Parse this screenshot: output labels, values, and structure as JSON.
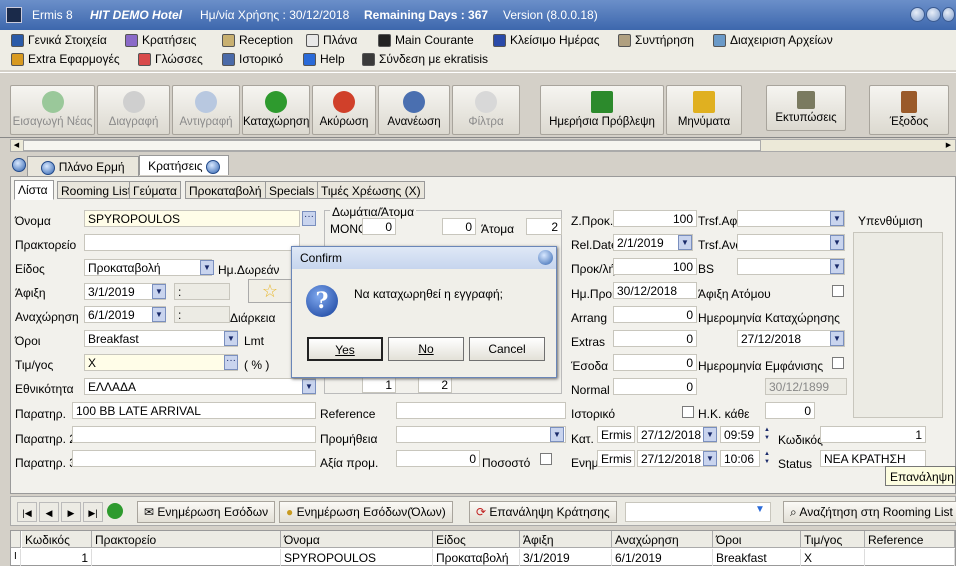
{
  "titlebar": {
    "app": "Ermis 8",
    "hotel": "HIT DEMO Hotel",
    "date_label": "Ημ/νία Χρήσης : 30/12/2018",
    "remaining": "Remaining Days : 367",
    "version": "Version (8.0.0.18)"
  },
  "menu": {
    "row1": [
      "Γενικά Στοιχεία",
      "Κρατήσεις",
      "Reception",
      "Πλάνα",
      "Main Courante",
      "Κλείσιμο Ημέρας",
      "Συντήρηση",
      "Διαχειριση Αρχείων"
    ],
    "row2": [
      "Extra Εφαρμογές",
      "Γλώσσες",
      "Ιστορικό",
      "Help",
      "Σύνδεση με ekratisis"
    ]
  },
  "toolbar": {
    "new": "Εισαγωγή Νέας",
    "delete": "Διαγραφή",
    "copy": "Αντιγραφή",
    "save": "Καταχώρηση",
    "cancel": "Ακύρωση",
    "refresh": "Ανανέωση",
    "filter": "Φίλτρα",
    "forecast": "Ημερήσια Πρόβλεψη",
    "messages": "Μηνύματα",
    "prints": "Εκτυπώσεις",
    "exit": "Έξοδος",
    "colors": {
      "save": "#2e9a2e",
      "cancel": "#d0402a",
      "refresh": "#4a6fb0",
      "forecast": "#2c8a2c",
      "messages": "#e0b020",
      "prints": "#7a7a60",
      "exit": "#9a5a2a"
    }
  },
  "doc_tabs": [
    "Πλάνο Ερμή",
    "Κρατήσεις"
  ],
  "sub_tabs": [
    "Λίστα",
    "Rooming List",
    "Γεύματα",
    "Προκαταβολή",
    "Specials",
    "Τιμές Χρέωσης (X)"
  ],
  "form": {
    "name_label": "Όνομα",
    "name": "SPYROPOULOS",
    "agency_label": "Πρακτορείο",
    "agency": "",
    "type_label": "Είδος",
    "type": "Προκαταβολή",
    "free_days_label": "Ημ.Δωρεάν",
    "arrival_label": "Άφιξη",
    "arrival": "3/1/2019",
    "arrival_sep": ":",
    "departure_label": "Αναχώρηση",
    "departure": "6/1/2019",
    "departure_sep": ":",
    "duration_label": "Διάρκεια",
    "terms_label": "Όροι",
    "terms": "Breakfast",
    "lmt_label": "Lmt",
    "pricelist_label": "Τιμ/γος",
    "pricelist": "X",
    "pct_label": "( % )",
    "nationality_label": "Εθνικότητα",
    "nationality": "ΕΛΛΑΔΑ",
    "notes_label": "Παρατηρ.",
    "notes": "100 BB LATE ARRIVAL",
    "notes2_label": "Παρατηρ. 2",
    "notes3_label": "Παρατηρ. 3",
    "reference_label": "Reference",
    "commission_label": "Προμήθεια",
    "commission_value_label": "Αξία προμ.",
    "commission_value": "0",
    "percent_label": "Ποσοστό",
    "rooms_group": "Δωμάτια/Άτομα",
    "mono_label": "ΜΟΝΟ",
    "mono": "0",
    "mono2": "0",
    "persons_label": "Άτομα",
    "persons": "2",
    "row_bottom_1": "1",
    "row_bottom_2": "2",
    "zprok_label": "Z.Προκ.",
    "zprok": "100",
    "reldate_label": "Rel.Date",
    "reldate": "2/1/2019",
    "prokl_label": "Προκ/λή",
    "prokl": "100",
    "hmprok_label": "Ημ.Προκ.",
    "hmprok": "30/12/2018",
    "arrang_label": "Arrang",
    "arrang": "0",
    "extras_label": "Extras",
    "extras": "0",
    "esoda_label": "Έσοδα",
    "esoda": "0",
    "normal_label": "Normal",
    "normal": "0",
    "istoriko_label": "Ιστορικό",
    "trsf_afix_label": "Trsf.Αφιξ",
    "trsf_ana_label": "Trsf.Ανα",
    "bs_label": "BS",
    "afixi_atomou_label": "Άφιξη Ατόμου",
    "reg_date_label": "Ημερομηνία Καταχώρησης",
    "reg_date": "27/12/2018",
    "display_date_label": "Ημερομηνία Εμφάνισης",
    "display_date": "30/12/1899",
    "hk_label": "Η.Κ. κάθε",
    "hk": "0",
    "reminder_label": "Υπενθύμιση",
    "created_label": "Κατ.",
    "created_user": "Ermis",
    "created_date": "27/12/2018",
    "created_time": "09:59",
    "code_label": "Κωδικός",
    "code": "1",
    "updated_label": "Ενημ.",
    "updated_user": "Ermis",
    "updated_date": "27/12/2018",
    "updated_time": "10:06",
    "status_label": "Status",
    "status": "ΝΕΑ ΚΡΑΤΗΣΗ"
  },
  "dialog": {
    "title": "Confirm",
    "message": "Να καταχωρηθεί η εγγραφή;",
    "yes": "Yes",
    "no": "No",
    "cancel": "Cancel"
  },
  "tooltip": "Επανάληψη Κ",
  "nav": {
    "update_income": "Ενημέρωση Εσόδων",
    "update_income_all": "Ενημέρωση Εσόδων(Όλων)",
    "repeat": "Επανάληψη Κράτησης",
    "search_rooming": "Αναζήτηση στη Rooming List"
  },
  "grid": {
    "headers": [
      "Κωδικός",
      "Πρακτορείο",
      "Όνομα",
      "Είδος",
      "Άφιξη",
      "Αναχώρηση",
      "Όροι",
      "Τιμ/γος",
      "Reference"
    ],
    "row": [
      "1",
      "",
      "SPYROPOULOS",
      "Προκαταβολή",
      "3/1/2019",
      "6/1/2019",
      "Breakfast",
      "X",
      ""
    ],
    "row_marker": "I"
  }
}
